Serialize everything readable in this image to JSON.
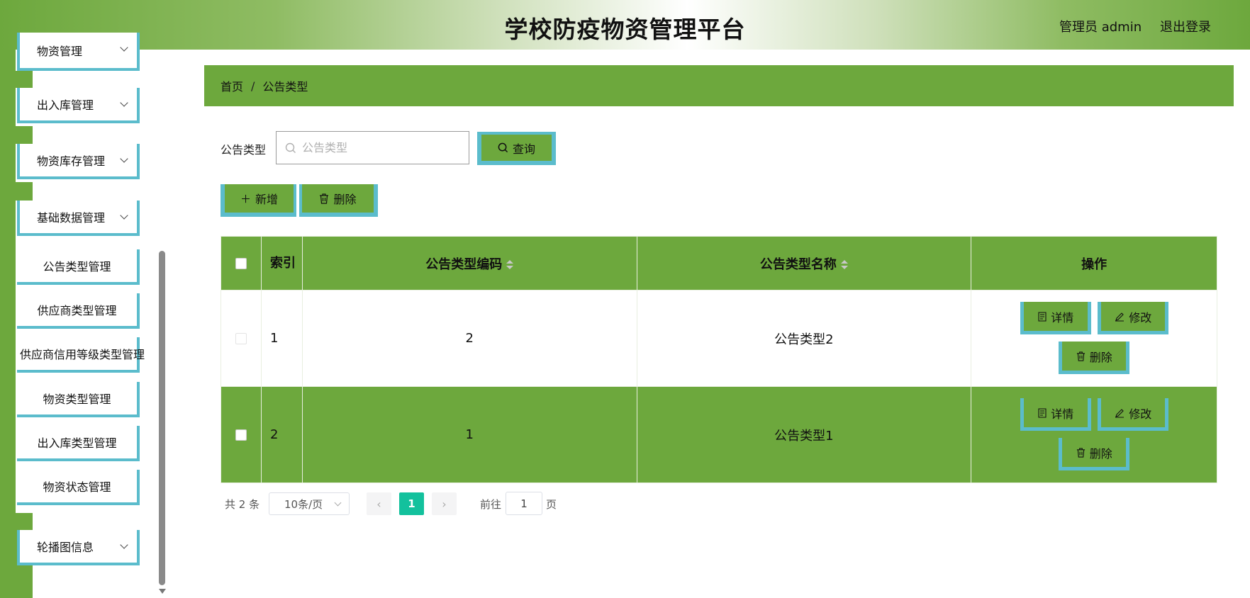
{
  "header": {
    "title": "学校防疫物资管理平台",
    "user": "管理员 admin",
    "logout": "退出登录"
  },
  "sidebar": {
    "groups": [
      "物资管理",
      "出入库管理",
      "物资库存管理",
      "基础数据管理"
    ],
    "sub_items": [
      "公告类型管理",
      "供应商类型管理",
      "供应商信用等级类型管理",
      "物资类型管理",
      "出入库类型管理",
      "物资状态管理"
    ],
    "carousel": "轮播图信息"
  },
  "breadcrumb": {
    "home": "首页",
    "sep": "/",
    "current": "公告类型"
  },
  "search": {
    "label": "公告类型",
    "placeholder": "公告类型",
    "value": "",
    "query_button": "查询"
  },
  "actions": {
    "add": "新增",
    "delete": "删除"
  },
  "table": {
    "columns": {
      "index": "索引",
      "code": "公告类型编码",
      "name": "公告类型名称",
      "ops": "操作"
    },
    "rows": [
      {
        "index": "1",
        "code": "2",
        "name": "公告类型2"
      },
      {
        "index": "2",
        "code": "1",
        "name": "公告类型1"
      }
    ],
    "row_ops": {
      "detail": "详情",
      "edit": "修改",
      "delete": "删除"
    }
  },
  "pagination": {
    "total": "共 2 条",
    "page_size": "10条/页",
    "current_page": "1",
    "goto_label": "前往",
    "goto_value": "1",
    "page_suffix": "页"
  },
  "colors": {
    "primary_green": "#6da83d",
    "accent_cyan": "#5bbccc",
    "active_page": "#13c19d"
  }
}
